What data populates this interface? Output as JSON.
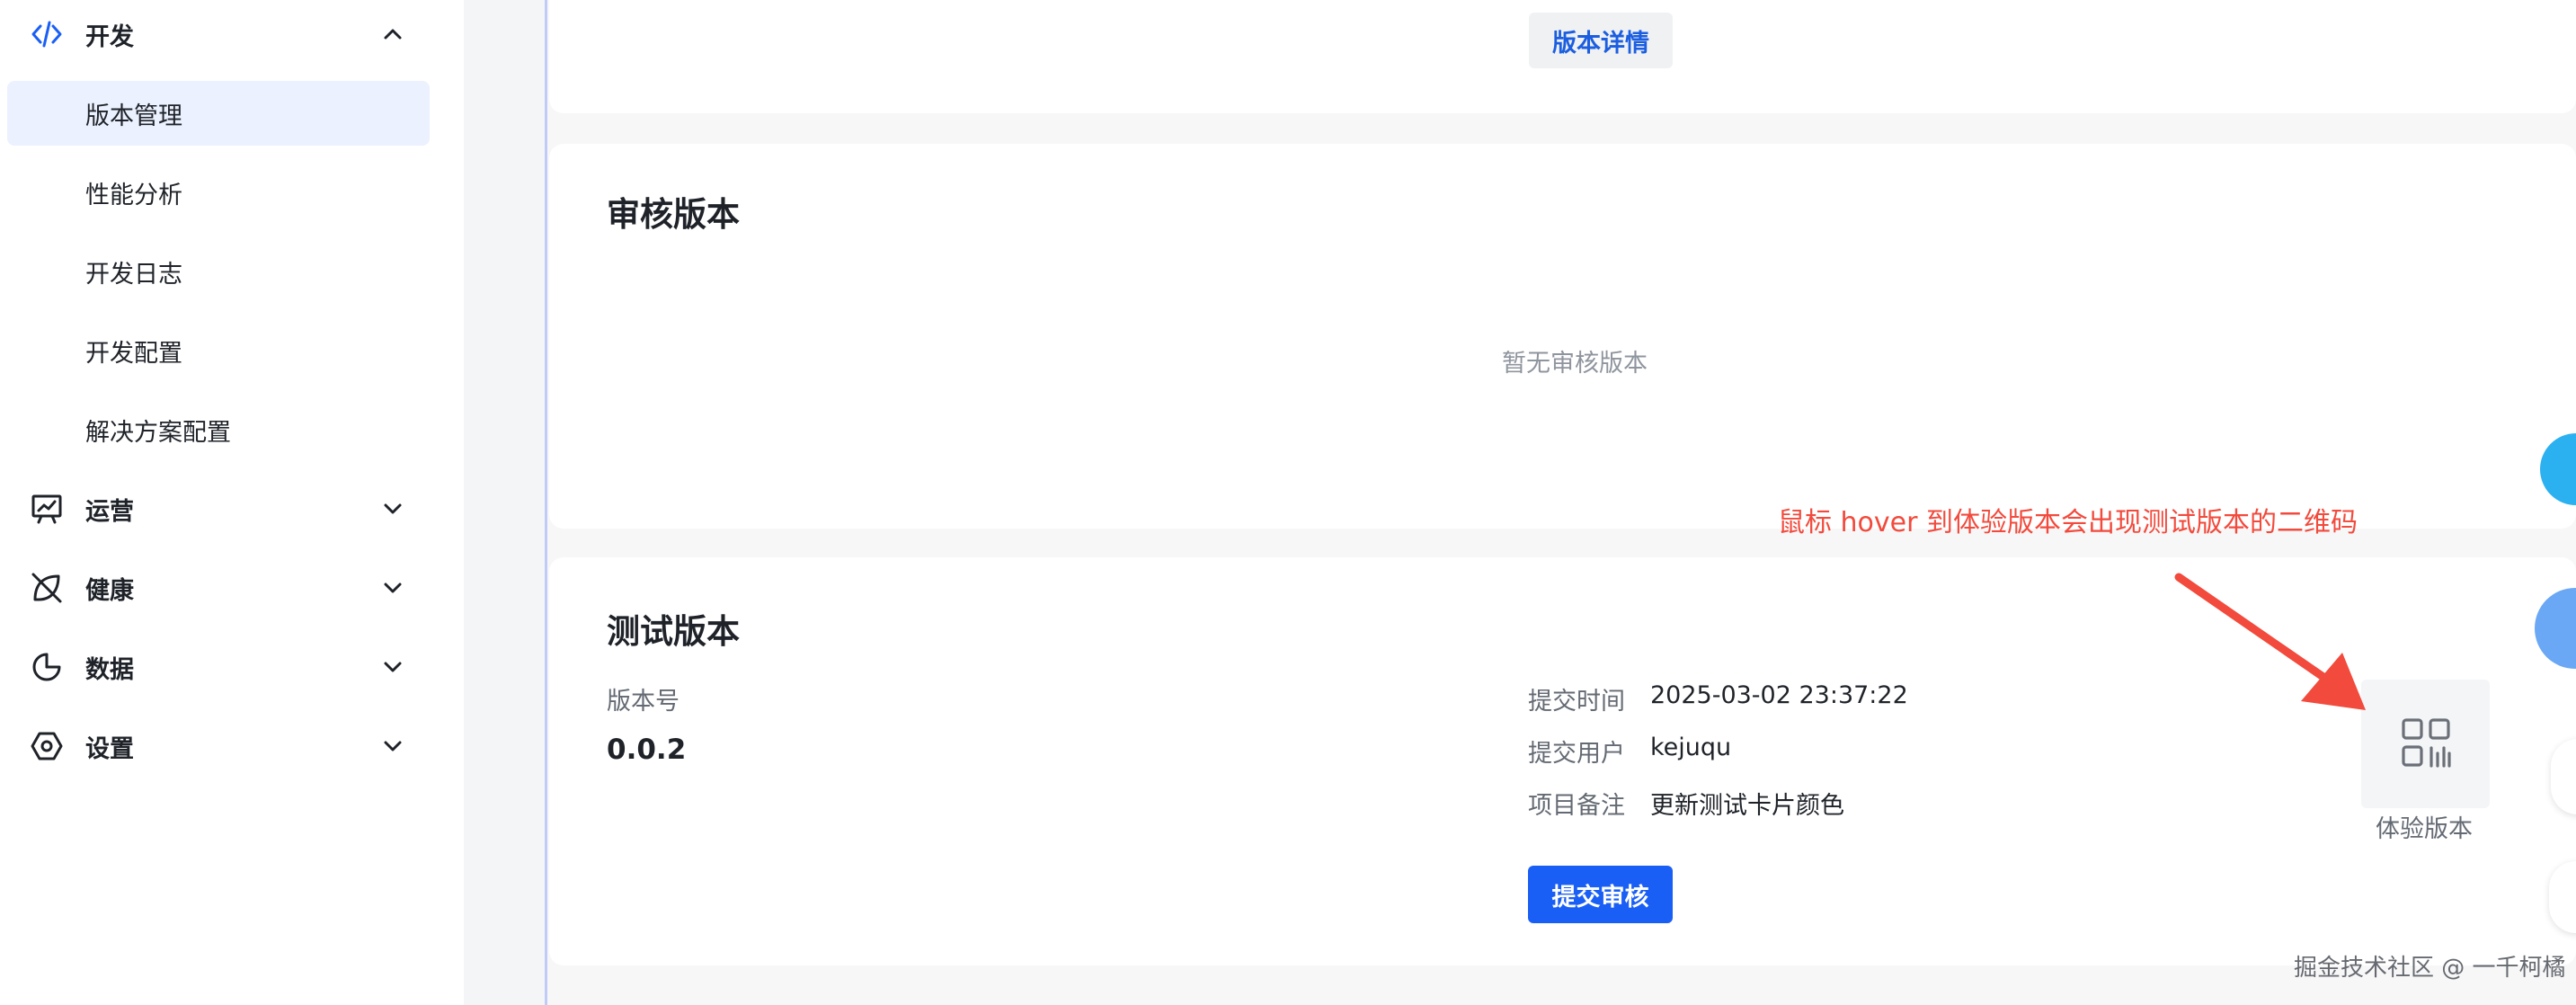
{
  "sidebar": {
    "dev": {
      "label": "开发",
      "icon": "code-icon",
      "expanded": true
    },
    "dev_items": [
      {
        "label": "版本管理",
        "active": true
      },
      {
        "label": "性能分析",
        "active": false
      },
      {
        "label": "开发日志",
        "active": false
      },
      {
        "label": "开发配置",
        "active": false
      },
      {
        "label": "解决方案配置",
        "active": false
      }
    ],
    "sections": [
      {
        "label": "运营",
        "icon": "presentation-chart-icon"
      },
      {
        "label": "健康",
        "icon": "leaf-icon"
      },
      {
        "label": "数据",
        "icon": "pie-chart-icon"
      },
      {
        "label": "设置",
        "icon": "hexagon-settings-icon"
      }
    ]
  },
  "top_card": {
    "details_button": "版本详情"
  },
  "review_card": {
    "title": "审核版本",
    "empty_text": "暂无审核版本"
  },
  "test_card": {
    "title": "测试版本",
    "version_label": "版本号",
    "version_value": "0.0.2",
    "submit_time_label": "提交时间",
    "submit_time_value": "2025-03-02 23:37:22",
    "submit_user_label": "提交用户",
    "submit_user_value": "kejuqu",
    "remark_label": "项目备注",
    "remark_value": "更新测试卡片颜色",
    "submit_button": "提交审核",
    "preview_label": "体验版本",
    "preview_icon": "qr-code-icon"
  },
  "annotation": "鼠标 hover 到体验版本会出现测试版本的二维码",
  "watermark": "掘金技术社区 @ 一千柯橘",
  "colors": {
    "accent": "#1a5ff5",
    "active_bg": "#ebf1fe",
    "annotation": "#f24a3c"
  }
}
